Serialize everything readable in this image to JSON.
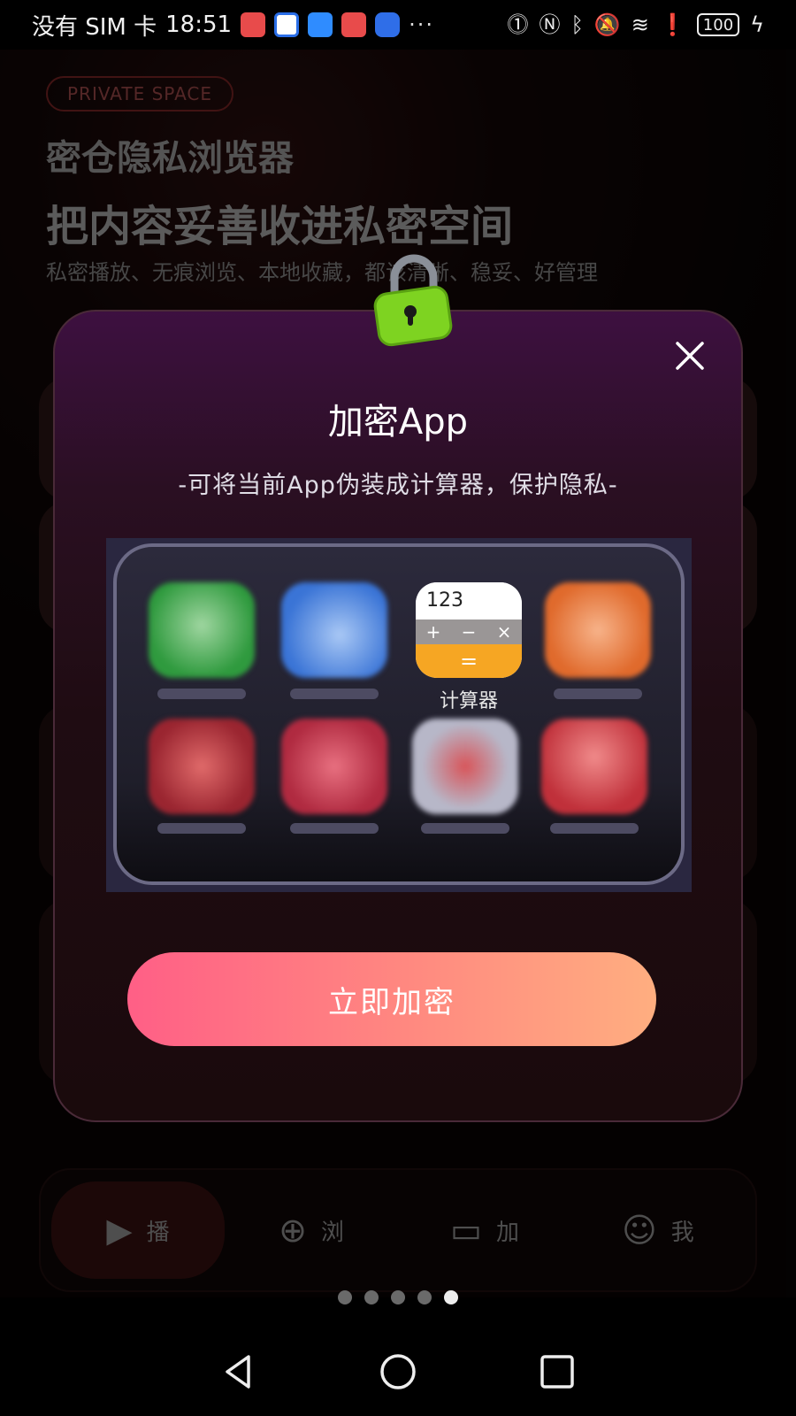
{
  "status_bar": {
    "carrier": "没有 SIM 卡",
    "time": "18:51",
    "more": "···",
    "battery": "100"
  },
  "background": {
    "badge": "PRIVATE SPACE",
    "title": "密仓隐私浏览器",
    "heading": "把内容妥善收进私密空间",
    "description": "私密播放、无痕浏览、本地收藏，都该清晰、稳妥、好管理",
    "nav": [
      {
        "label": "播",
        "icon": "play-icon"
      },
      {
        "label": "浏",
        "icon": "browse-icon"
      },
      {
        "label": "加",
        "icon": "folder-lock-icon"
      },
      {
        "label": "我",
        "icon": "person-icon"
      }
    ],
    "page_index": {
      "total": 5,
      "active": 5
    }
  },
  "modal": {
    "title": "加密App",
    "subtitle": "-可将当前App伪装成计算器，保护隐私-",
    "calculator": {
      "display": "123",
      "ops": [
        "+",
        "−",
        "×"
      ],
      "equals": "=",
      "name": "计算器"
    },
    "cta_label": "立即加密"
  },
  "colors": {
    "cta_gradient_start": "#ff5f86",
    "cta_gradient_end": "#ffae80",
    "lock_green": "#7ed321"
  }
}
